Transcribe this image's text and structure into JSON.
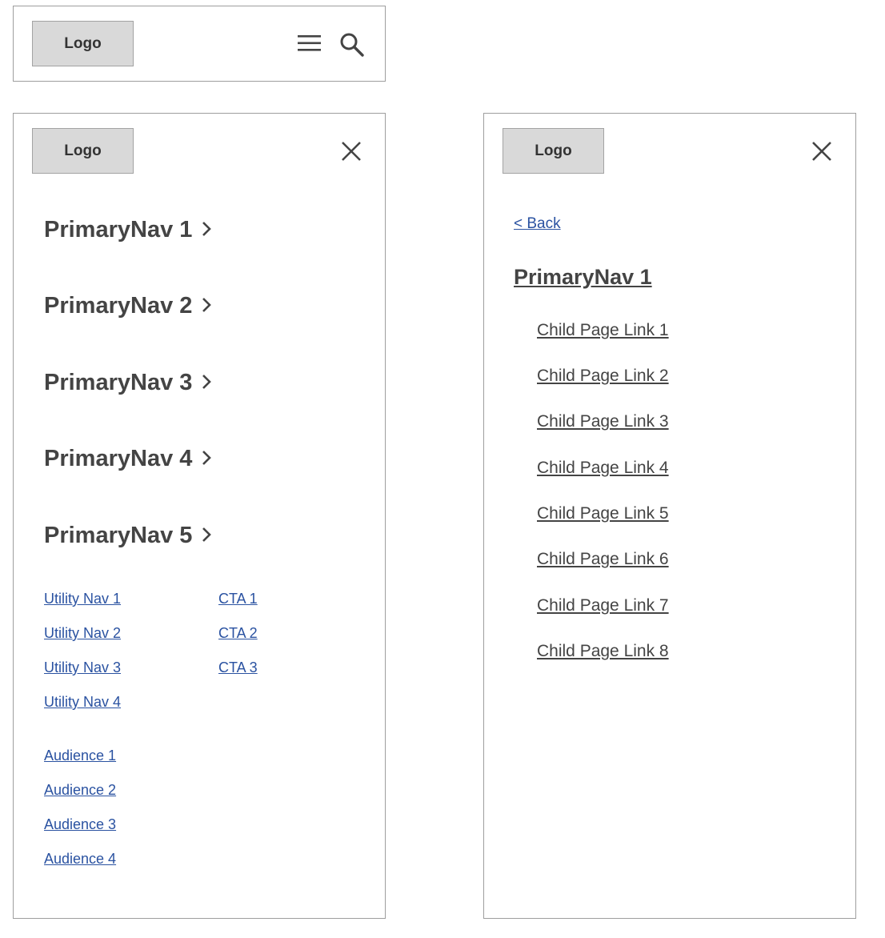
{
  "header": {
    "logo": "Logo",
    "menu_icon": "hamburger-icon",
    "search_icon": "search-icon"
  },
  "menu_open": {
    "logo": "Logo",
    "close_icon": "close-icon",
    "primary": [
      {
        "label": "PrimaryNav 1"
      },
      {
        "label": "PrimaryNav 2"
      },
      {
        "label": "PrimaryNav 3"
      },
      {
        "label": "PrimaryNav 4"
      },
      {
        "label": "PrimaryNav 5"
      }
    ],
    "utility": [
      "Utility Nav 1",
      "Utility Nav 2",
      "Utility Nav 3",
      "Utility Nav 4"
    ],
    "cta": [
      "CTA 1",
      "CTA 2",
      "CTA 3"
    ],
    "audience": [
      "Audience 1",
      "Audience 2",
      "Audience 3",
      "Audience 4"
    ]
  },
  "submenu": {
    "logo": "Logo",
    "close_icon": "close-icon",
    "back": "< Back",
    "title": "PrimaryNav 1",
    "children": [
      "Child Page Link 1",
      "Child Page Link 2",
      "Child Page Link 3",
      "Child Page Link 4",
      "Child Page Link 5",
      "Child Page Link 6",
      "Child Page Link 7",
      "Child Page Link 8"
    ]
  },
  "colors": {
    "link": "#2a52a1",
    "text": "#444444",
    "logo_bg": "#d9d9d9",
    "border": "#9e9e9e"
  }
}
